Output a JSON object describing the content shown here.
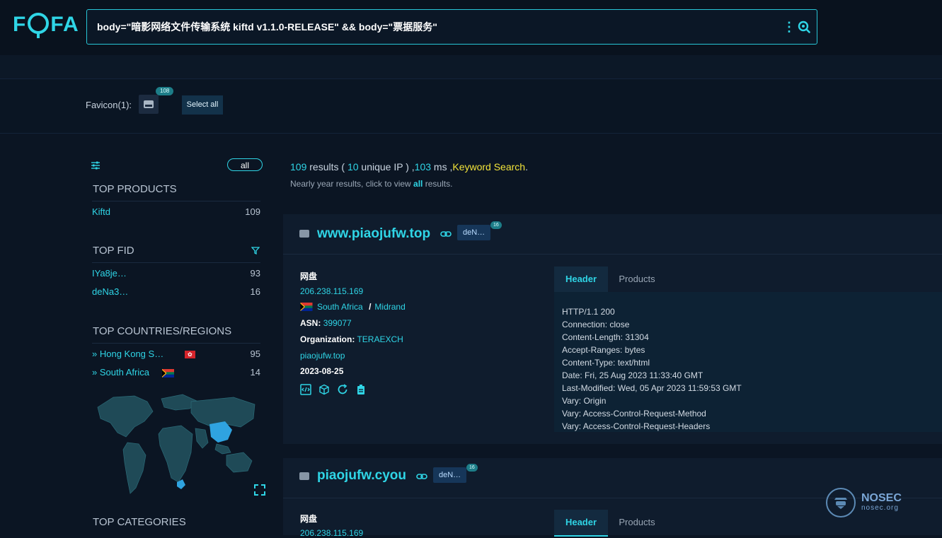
{
  "logo": "FOFA",
  "search": {
    "value": "body=\"暗影网络文件传输系统 kiftd v1.1.0-RELEASE\" && body=\"票据服务\""
  },
  "favicon": {
    "label": "Favicon(1):",
    "count": "108",
    "select_all": "Select all"
  },
  "sidebar": {
    "all_label": "all",
    "top_products": {
      "title": "TOP PRODUCTS",
      "items": [
        {
          "name": "Kiftd",
          "count": "109"
        }
      ]
    },
    "top_fid": {
      "title": "TOP FID",
      "items": [
        {
          "name": "IYa8je…",
          "count": "93"
        },
        {
          "name": "deNa3…",
          "count": "16"
        }
      ]
    },
    "top_countries": {
      "title": "TOP COUNTRIES/REGIONS",
      "items": [
        {
          "name": "Hong Kong S…",
          "count": "95"
        },
        {
          "name": "South Africa",
          "count": "14"
        }
      ]
    },
    "top_categories": {
      "title": "TOP CATEGORIES"
    }
  },
  "summary": {
    "count": "109",
    "results_word": " results ( ",
    "unique_ip": "10",
    "unique_word": " unique IP ) ,",
    "ms": "103",
    "ms_word": " ms ,",
    "keyword": "Keyword Search",
    "period": ".",
    "sub_prefix": "Nearly year results, click to view ",
    "sub_link": "all",
    "sub_suffix": " results."
  },
  "results": [
    {
      "host": "www.piaojufw.top",
      "fid": "deN…",
      "fid_count": "16",
      "title": "网盘",
      "ip": "206.238.115.169",
      "country": "South Africa",
      "sep": "/",
      "city": "Midrand",
      "asn_label": "ASN:",
      "asn": "399077",
      "org_label": "Organization:",
      "org": "TERAEXCH",
      "domain": "piaojufw.top",
      "date": "2023-08-25",
      "tabs": [
        "Header",
        "Products"
      ],
      "header_lines": [
        "HTTP/1.1 200",
        "Connection: close",
        "Content-Length: 31304",
        "Accept-Ranges: bytes",
        "Content-Type: text/html",
        "Date: Fri, 25 Aug 2023 11:33:40 GMT",
        "Last-Modified: Wed, 05 Apr 2023 11:59:53 GMT",
        "Vary: Origin",
        "Vary: Access-Control-Request-Method",
        "Vary: Access-Control-Request-Headers"
      ]
    },
    {
      "host": "piaojufw.cyou",
      "fid": "deN…",
      "fid_count": "16",
      "title": "网盘",
      "ip": "206.238.115.169",
      "tabs": [
        "Header",
        "Products"
      ]
    }
  ],
  "watermark": {
    "name": "NOSEC",
    "site": "nosec.org"
  },
  "colors": {
    "accent": "#2fd5e6",
    "background": "#0b1523",
    "keyword": "#f2e33a"
  }
}
